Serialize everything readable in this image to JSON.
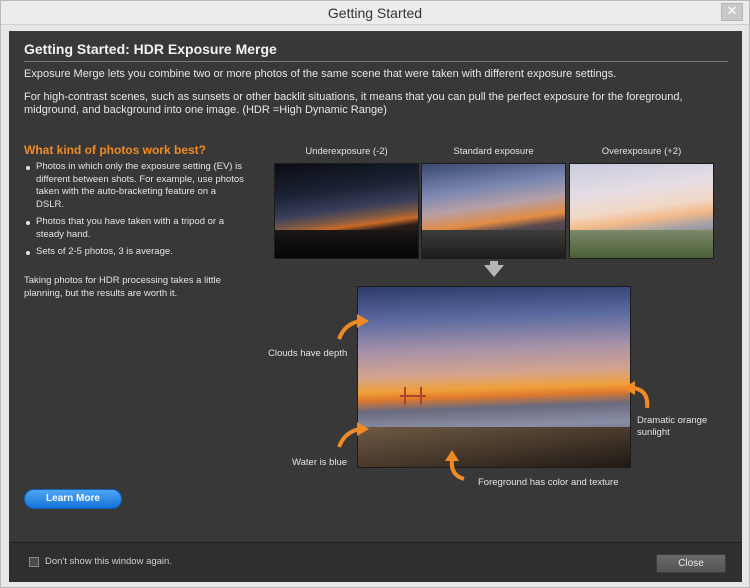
{
  "window": {
    "title": "Getting Started",
    "close_glyph": "✕"
  },
  "main": {
    "heading": "Getting Started: HDR Exposure Merge",
    "intro": "Exposure Merge lets you combine two or more photos of the same scene that were taken with different exposure settings.",
    "intro2": "For high-contrast scenes, such as sunsets or other backlit situations, it means that you can pull the perfect exposure for the foreground, midground, and background into one image. (HDR =High Dynamic Range)"
  },
  "left_panel": {
    "heading": "What kind of photos work best?",
    "bullets": [
      "Photos in which only the exposure setting (EV) is different between shots. For example, use photos taken with the auto-bracketing feature on a DSLR.",
      "Photos that you have taken with a tripod or a steady hand.",
      "Sets of 2-5 photos, 3 is average."
    ],
    "tip": "Taking photos for HDR processing takes a little planning, but the results are worth it.",
    "learn_more": "Learn More"
  },
  "exposures": [
    {
      "caption": "Underexposure (-2)"
    },
    {
      "caption": "Standard exposure"
    },
    {
      "caption": "Overexposure (+2)"
    }
  ],
  "callouts": {
    "clouds": "Clouds have depth",
    "water": "Water is blue",
    "foreground": "Foreground has color and texture",
    "sunlight": "Dramatic orange sunlight"
  },
  "colors": {
    "accent": "#f08a24",
    "button_blue": "#1572d8"
  },
  "footer": {
    "dont_show": "Don't show this window again.",
    "close": "Close"
  }
}
